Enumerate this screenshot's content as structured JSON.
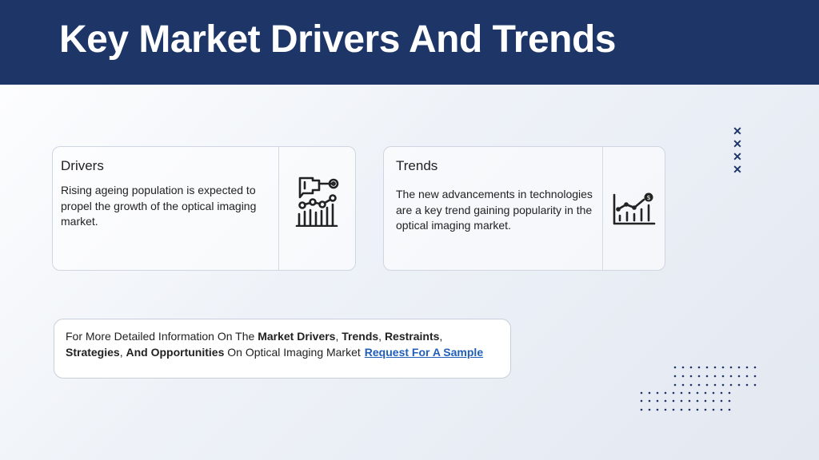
{
  "header": {
    "title": "Key Market Drivers And Trends"
  },
  "drivers": {
    "title": "Drivers",
    "body": "Rising ageing population is expected to propel the growth of the optical imaging market.",
    "icon": "presentation-chart-icon"
  },
  "trends": {
    "title": "Trends",
    "body": "The new advancements in technologies are a key trend gaining popularity in the optical imaging market.",
    "icon": "growth-chart-icon"
  },
  "cta": {
    "t1": "For More Detailed Information On The ",
    "b1": "Market Drivers",
    "t2": ", ",
    "b2": "Trends",
    "t3": ", ",
    "b3": "Restraints",
    "t4": ",",
    "b4": "Strategies",
    "t5": ", ",
    "b5": "And Opportunities",
    "t6": " On Optical Imaging Market",
    "link": "Request For A Sample"
  },
  "colors": {
    "header": "#1d3567",
    "link": "#1f5fb8"
  }
}
